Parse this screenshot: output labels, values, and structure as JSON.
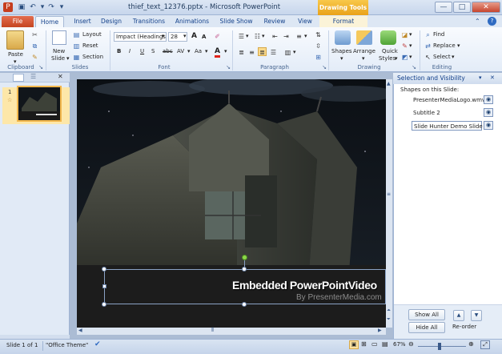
{
  "window": {
    "title": "thief_text_12376.pptx - Microsoft PowerPoint",
    "contextual_tab": "Drawing Tools",
    "minimize": "—",
    "maximize": "□",
    "close": "✕"
  },
  "tabs": [
    "File",
    "Home",
    "Insert",
    "Design",
    "Transitions",
    "Animations",
    "Slide Show",
    "Review",
    "View",
    "Format"
  ],
  "ribbon": {
    "clipboard": {
      "paste": "Paste",
      "label": "Clipboard"
    },
    "slides": {
      "new_slide_1": "New",
      "new_slide_2": "Slide",
      "layout": "Layout",
      "reset": "Reset",
      "section": "Section",
      "label": "Slides"
    },
    "font": {
      "font_name": "Impact (Headings",
      "font_size": "28",
      "bold": "B",
      "italic": "I",
      "underline": "U",
      "strike": "S",
      "shadow": "abc",
      "spacing": "AV",
      "case": "Aa",
      "grow": "A",
      "shrink": "A",
      "color": "A",
      "label": "Font"
    },
    "paragraph": {
      "label": "Paragraph"
    },
    "drawing": {
      "shapes": "Shapes",
      "arrange": "Arrange",
      "quick_styles_1": "Quick",
      "quick_styles_2": "Styles",
      "label": "Drawing"
    },
    "editing": {
      "find": "Find",
      "replace": "Replace",
      "select": "Select",
      "label": "Editing"
    }
  },
  "slides_panel": {
    "slide_number": "1",
    "star": "☆"
  },
  "slide": {
    "title": "Embedded PowerPointVideo",
    "subtitle": "By PresenterMedia.com"
  },
  "selection_pane": {
    "title": "Selection and Visibility",
    "shapes_label": "Shapes on this Slide:",
    "shapes": [
      "PresenterMediaLogo.wmv",
      "Subtitle 2",
      "Slide Hunter Demo Slide"
    ],
    "show_all": "Show All",
    "hide_all": "Hide All",
    "reorder": "Re-order"
  },
  "status": {
    "slide_info": "Slide 1 of 1",
    "theme": "\"Office Theme\"",
    "zoom": "67%"
  },
  "colors": {
    "accent_file": "#C54520",
    "drawing_tools": "#E9A21A",
    "selection_yellow": "#F2B74C"
  }
}
